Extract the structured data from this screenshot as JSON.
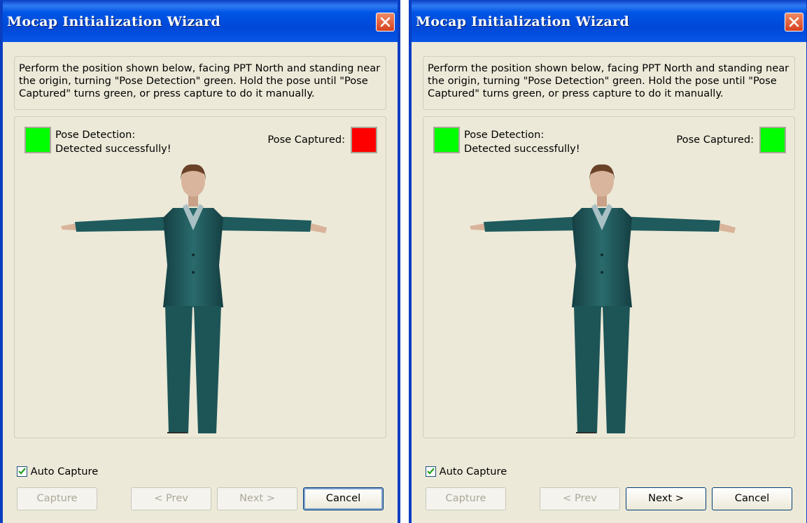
{
  "windows": [
    {
      "title": "Mocap Initialization Wizard",
      "instruction": "Perform the position shown below, facing PPT North and standing near the origin, turning \"Pose Detection\" green. Hold the pose until \"Pose Captured\" turns green, or press capture to do it manually.",
      "pose_detection_label": "Pose Detection:",
      "pose_detection_status": "Detected successfully!",
      "pose_detection_color": "#00ff00",
      "pose_captured_label": "Pose Captured:",
      "pose_captured_color": "#ff0000",
      "auto_capture_label": "Auto Capture",
      "auto_capture_checked": true,
      "buttons": {
        "capture": "Capture",
        "prev": "< Prev",
        "next": "Next >",
        "cancel": "Cancel"
      },
      "next_enabled": false
    },
    {
      "title": "Mocap Initialization Wizard",
      "instruction": "Perform the position shown below, facing PPT North and standing near the origin, turning \"Pose Detection\" green. Hold the pose until \"Pose Captured\" turns green, or press capture to do it manually.",
      "pose_detection_label": "Pose Detection:",
      "pose_detection_status": "Detected successfully!",
      "pose_detection_color": "#00ff00",
      "pose_captured_label": "Pose Captured:",
      "pose_captured_color": "#00ff00",
      "auto_capture_label": "Auto Capture",
      "auto_capture_checked": true,
      "buttons": {
        "capture": "Capture",
        "prev": "< Prev",
        "next": "Next >",
        "cancel": "Cancel"
      },
      "next_enabled": true
    }
  ],
  "colors": {
    "title_bar": "#0055e5",
    "close_button": "#d6401d",
    "dialog_bg": "#ece9d8",
    "suit": "#1f5a5c"
  },
  "icons": {
    "close": "close-icon",
    "checkbox": "checkmark-icon",
    "figure": "t-pose-figure"
  }
}
